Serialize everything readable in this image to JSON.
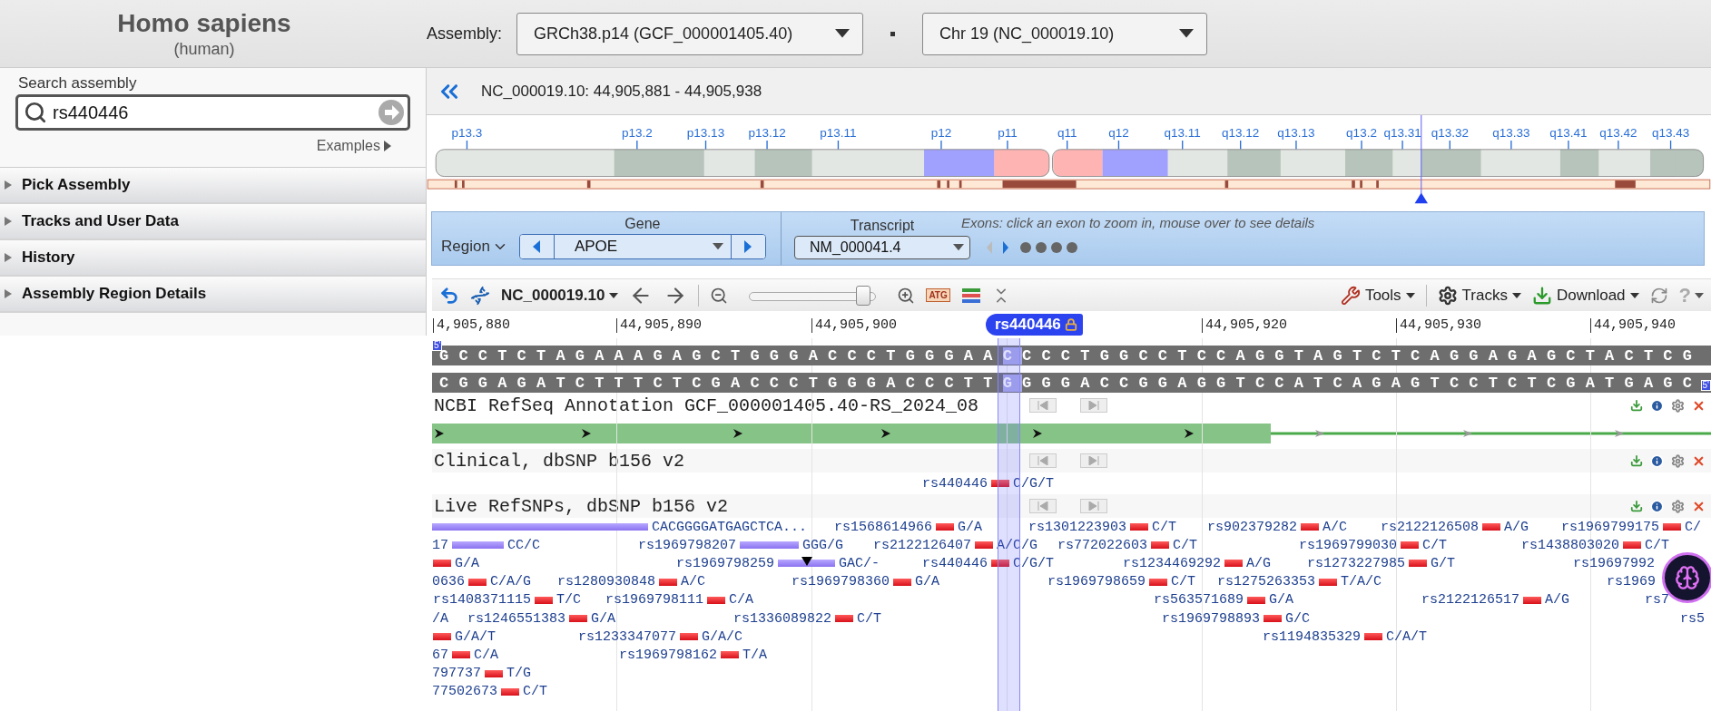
{
  "header": {
    "species": "Homo sapiens",
    "common_name": "(human)",
    "assembly_label": "Assembly:",
    "assembly": "GRCh38.p14 (GCF_000001405.40)",
    "chromosome": "Chr 19 (NC_000019.10)"
  },
  "sidebar": {
    "search_label": "Search assembly",
    "search_value": "rs440446",
    "examples": "Examples",
    "sections": [
      {
        "label": "Pick Assembly",
        "expanded": false
      },
      {
        "label": "Tracks and User Data",
        "expanded": false
      },
      {
        "label": "History",
        "expanded": false
      },
      {
        "label": "Assembly Region Details",
        "expanded": false
      }
    ]
  },
  "location": "NC_000019.10: 44,905,881 - 44,905,938",
  "ideogram": {
    "bands": [
      "p13.3",
      "p13.2",
      "p13.13",
      "p13.12",
      "p13.11",
      "p12",
      "p11",
      "q11",
      "q12",
      "q13.11",
      "q13.12",
      "q13.13",
      "q13.2",
      "q13.31",
      "q13.32",
      "q13.33",
      "q13.41",
      "q13.42",
      "q13.43"
    ]
  },
  "region_nav": {
    "region_label": "Region",
    "gene_label": "Gene",
    "gene": "APOE",
    "transcript_label": "Transcript",
    "transcript": "NM_000041.4",
    "exons_hint": "Exons: click an exon to zoom in, mouse over to see details"
  },
  "toolbar": {
    "sequence": "NC_000019.10",
    "sequence_button": "ATG",
    "zoom": {
      "level": 0.9
    },
    "tools": "Tools",
    "tracks": "Tracks",
    "download": "Download",
    "help": "?"
  },
  "ruler": [
    "4,905,880",
    "44,905,890",
    "44,905,900",
    "44,905,920",
    "44,905,930",
    "44,905,940"
  ],
  "marker": {
    "label": "rs440446"
  },
  "sequence": {
    "forward": {
      "before": "GCCTCTAGAAAGAGCTGGGACCCTGGGAA",
      "marked": "C",
      "after": "CCCTGGCCTCCAGGTAGTCTCAGGAGAGCTACTCG"
    },
    "reverse": {
      "before": "CGGAGATCTTTCTCGACCCTGGGACCCTT",
      "marked": "G",
      "after": "GGGACCGGAGGTCCATCAGAGTCCTCTCGATGAGC"
    },
    "strand_marks": [
      "5'",
      "5'"
    ]
  },
  "tracks": [
    {
      "kind": "gene",
      "title": "NCBI RefSeq Annotation GCF_000001405.40-RS_2024_08"
    },
    {
      "kind": "variants",
      "title": "Clinical, dbSNP b156 v2",
      "rows": [
        [
          {
            "kind": "snp",
            "name": "rs440446",
            "alleles": "C/G/T"
          }
        ]
      ]
    },
    {
      "kind": "variants",
      "title": "Live RefSNPs, dbSNP b156 v2",
      "rows": [
        [
          {
            "kind": "indel",
            "alleles": "CACGGGGATGAGCTCA...",
            "marked": false
          },
          {
            "kind": "snp",
            "name": "rs1568614966",
            "alleles": "G/A"
          },
          {
            "kind": "snp",
            "name": "rs1301223903",
            "alleles": "C/T"
          },
          {
            "kind": "snp",
            "name": "rs902379282",
            "alleles": "A/C"
          },
          {
            "kind": "snp",
            "name": "rs2122126508",
            "alleles": "A/G"
          },
          {
            "kind": "snp",
            "name": "rs1969799175",
            "alleles": "C/"
          }
        ],
        [
          {
            "kind": "indel",
            "name": "17",
            "alleles": "CC/C",
            "marked": false
          },
          {
            "kind": "indel",
            "name": "rs1969798207",
            "alleles": "GGG/G",
            "marked": false
          },
          {
            "kind": "snp",
            "name": "rs2122126407",
            "alleles": "A/C/G"
          },
          {
            "kind": "snp",
            "name": "rs772022603",
            "alleles": "C/T"
          },
          {
            "kind": "snp",
            "name": "rs1969799030",
            "alleles": "C/T"
          },
          {
            "kind": "snp",
            "name": "rs1438803020",
            "alleles": "C/T"
          }
        ],
        [
          {
            "kind": "snp",
            "alleles": "G/A"
          },
          {
            "kind": "indel",
            "name": "rs1969798259",
            "alleles": "GAC/-",
            "marked": true
          },
          {
            "kind": "snp",
            "name": "rs440446",
            "alleles": "C/G/T"
          },
          {
            "kind": "snp",
            "name": "rs1234469292",
            "alleles": "A/G"
          },
          {
            "kind": "snp",
            "name": "rs1273227985",
            "alleles": "G/T"
          },
          {
            "kind": "label",
            "name": "rs19697992"
          }
        ],
        [
          {
            "kind": "snp",
            "name": "0636",
            "alleles": "C/A/G"
          },
          {
            "kind": "snp",
            "name": "rs1280930848",
            "alleles": "A/C"
          },
          {
            "kind": "snp",
            "name": "rs1969798360",
            "alleles": "G/A"
          },
          {
            "kind": "snp",
            "name": "rs1969798659",
            "alleles": "C/T"
          },
          {
            "kind": "snp",
            "name": "rs1275263353",
            "alleles": "T/A/C"
          },
          {
            "kind": "label",
            "name": "rs1969"
          }
        ],
        [
          {
            "kind": "snp",
            "name": "rs1408371115",
            "alleles": "T/C"
          },
          {
            "kind": "snp",
            "name": "rs1969798111",
            "alleles": "C/A"
          },
          {
            "kind": "snp",
            "name": "rs563571689",
            "alleles": "G/A"
          },
          {
            "kind": "snp",
            "name": "rs2122126517",
            "alleles": "A/G"
          },
          {
            "kind": "label",
            "name": "rs7"
          }
        ],
        [
          {
            "kind": "label",
            "name": "/A"
          },
          {
            "kind": "snp",
            "name": "rs1246551383",
            "alleles": "G/A"
          },
          {
            "kind": "snp",
            "name": "rs1336089822",
            "alleles": "C/T"
          },
          {
            "kind": "snp",
            "name": "rs1969798893",
            "alleles": "G/C"
          },
          {
            "kind": "label",
            "name": "rs5"
          }
        ],
        [
          {
            "kind": "snp",
            "alleles": "G/A/T"
          },
          {
            "kind": "snp",
            "name": "rs1233347077",
            "alleles": "G/A/C"
          },
          {
            "kind": "snp",
            "name": "rs1194835329",
            "alleles": "C/A/T"
          }
        ],
        [
          {
            "kind": "snp",
            "name": "67",
            "alleles": "C/A"
          },
          {
            "kind": "snp",
            "name": "rs1969798162",
            "alleles": "T/A"
          }
        ],
        [
          {
            "kind": "snp",
            "name": "797737",
            "alleles": "T/G"
          }
        ],
        [
          {
            "kind": "snp",
            "name": "77502673",
            "alleles": "C/T"
          }
        ]
      ]
    }
  ]
}
